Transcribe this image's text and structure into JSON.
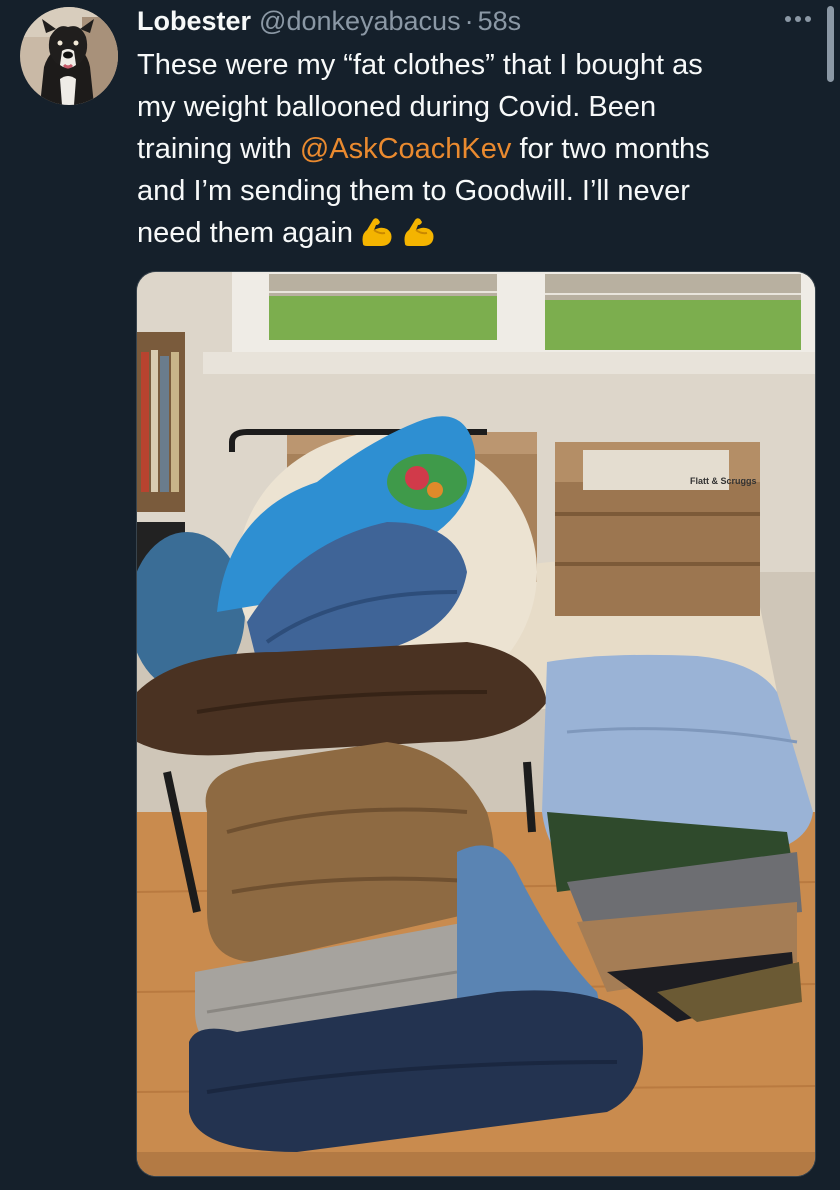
{
  "tweet": {
    "display_name": "Lobester",
    "handle": "@donkeyabacus",
    "separator": "·",
    "timestamp": "58s",
    "text_lines": [
      "These were my “fat clothes” that I bought as",
      "my weight ballooned during Covid. Been",
      "and I’m sending them to Goodwill. I’ll never",
      "need them again"
    ],
    "line3_prefix": "training with ",
    "mention": "@AskCoachKev",
    "line3_suffix": " for two months",
    "emojis": [
      "flexed-biceps",
      "flexed-biceps"
    ]
  },
  "media": {
    "crate_label": "Flatt & Scruggs"
  },
  "colors": {
    "background": "#15202b",
    "text": "#f7f9f9",
    "secondary": "#8b98a5",
    "mention": "#ea8a2f"
  }
}
